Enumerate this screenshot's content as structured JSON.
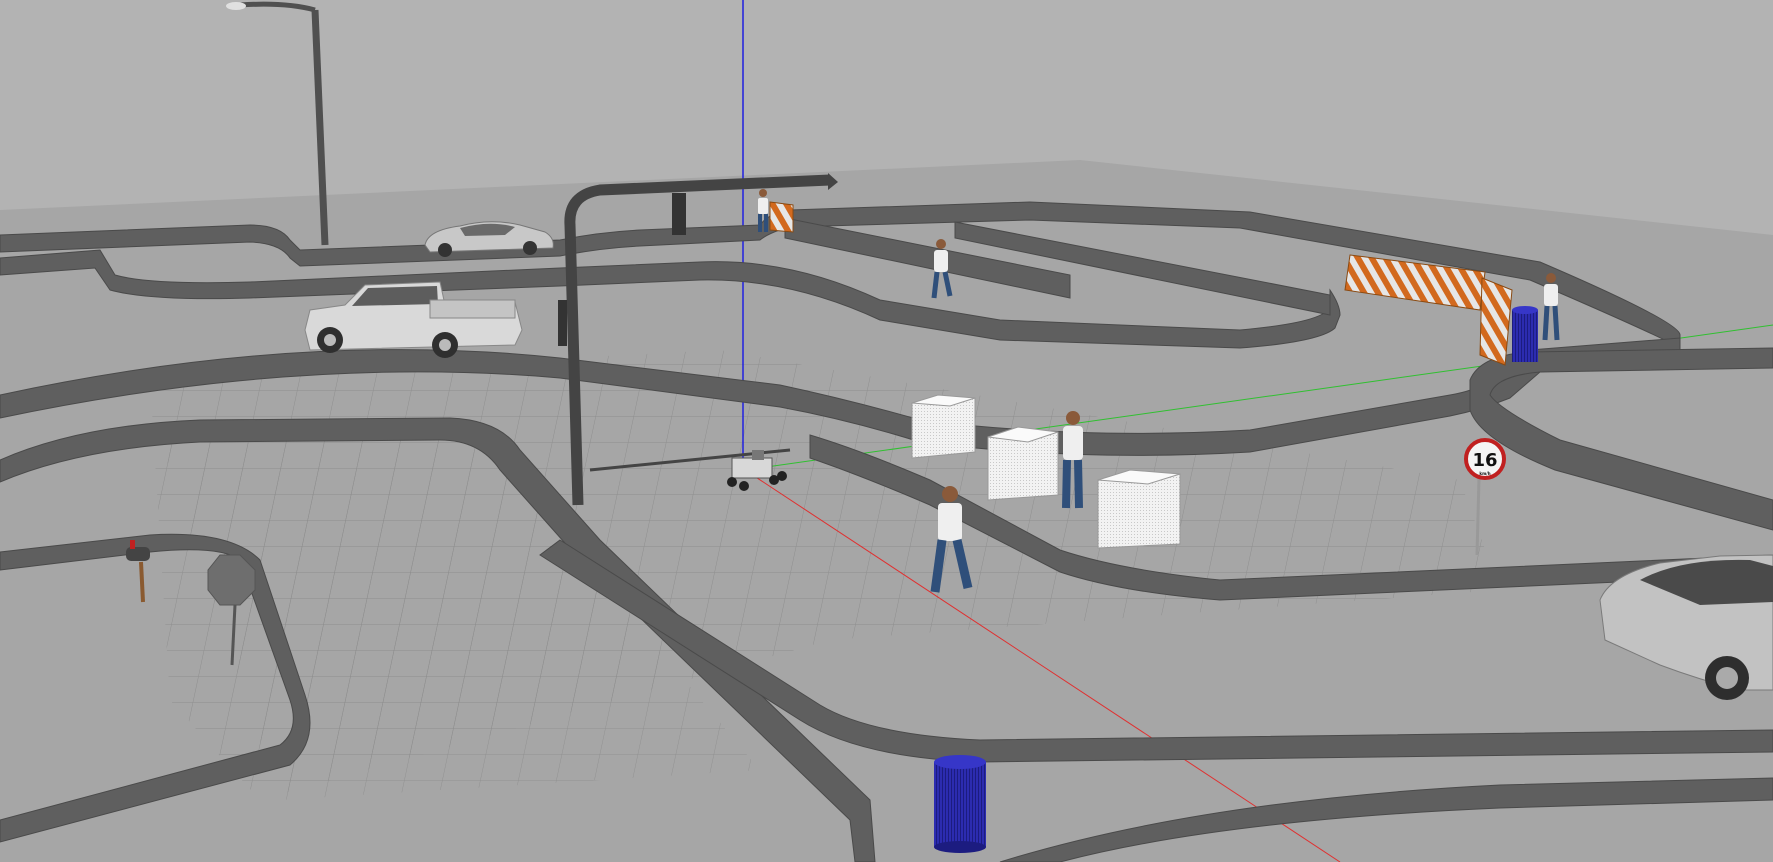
{
  "scene": {
    "sky_color": "#b3b3b3",
    "ground_color": "#a6a6a6",
    "track_wall_color": "#5c5c5c",
    "grid_color": "#8f8f8f",
    "axis_colors": {
      "x": "#e03030",
      "y": "#30c030",
      "z": "#2020e0"
    },
    "speed_sign": {
      "number": "16",
      "subtext": "km/h"
    },
    "objects": {
      "street_lamp": "street-lamp",
      "traffic_light": "traffic-light-pole",
      "sedan_far": "sedan-car-far",
      "pickup": "pickup-truck",
      "sedan_near": "sedan-car-near",
      "barrier": "construction-barrier",
      "trash_can": "blue-trash-can",
      "mailbox": "mailbox",
      "stop_sign_back": "stop-sign-back",
      "robot": "robot-car",
      "pedestrian": "pedestrian",
      "box": "white-box"
    }
  }
}
